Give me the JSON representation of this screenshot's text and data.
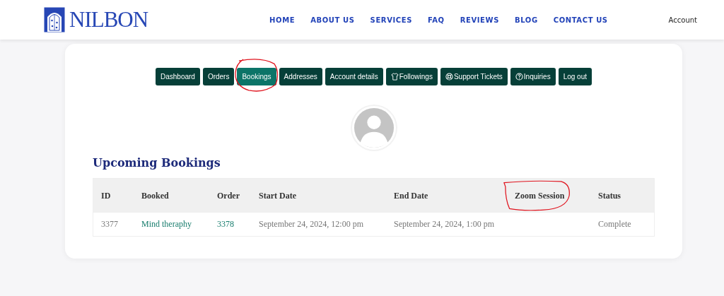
{
  "header": {
    "logo": "NILBON",
    "nav": [
      {
        "label": "HOME"
      },
      {
        "label": "ABOUT US"
      },
      {
        "label": "SERVICES"
      },
      {
        "label": "FAQ"
      },
      {
        "label": "REVIEWS"
      },
      {
        "label": "BLOG"
      },
      {
        "label": "CONTACT US"
      }
    ],
    "account": "Account"
  },
  "tabs": [
    {
      "label": "Dashboard",
      "kind": "plain",
      "selected": false,
      "annotated": false
    },
    {
      "label": "Orders",
      "kind": "plain",
      "selected": false,
      "annotated": false
    },
    {
      "label": "Bookings",
      "kind": "plain",
      "selected": true,
      "annotated": true
    },
    {
      "label": "Addresses",
      "kind": "plain",
      "selected": false,
      "annotated": false
    },
    {
      "label": "Account details",
      "kind": "plain",
      "selected": false,
      "annotated": false
    },
    {
      "label": "Followings",
      "kind": "shirt",
      "selected": false,
      "annotated": false
    },
    {
      "label": "Support Tickets",
      "kind": "lifebuoy",
      "selected": false,
      "annotated": false
    },
    {
      "label": "Inquiries",
      "kind": "question",
      "selected": false,
      "annotated": false
    },
    {
      "label": "Log out",
      "kind": "plain",
      "selected": false,
      "annotated": false
    }
  ],
  "heading": "Upcoming Bookings",
  "table": {
    "columns": [
      {
        "label": "ID",
        "annotated": false
      },
      {
        "label": "Booked",
        "annotated": false
      },
      {
        "label": "Order",
        "annotated": false
      },
      {
        "label": "Start Date",
        "annotated": false
      },
      {
        "label": "End Date",
        "annotated": false
      },
      {
        "label": "Zoom Session",
        "annotated": true
      },
      {
        "label": "Status",
        "annotated": false
      }
    ],
    "rows": [
      {
        "id": "3377",
        "booked": "Mind theraphy",
        "order": "3378",
        "start": "September 24, 2024, 12:00 pm",
        "end": "September 24, 2024, 1:00 pm",
        "status": "Complete"
      }
    ]
  }
}
